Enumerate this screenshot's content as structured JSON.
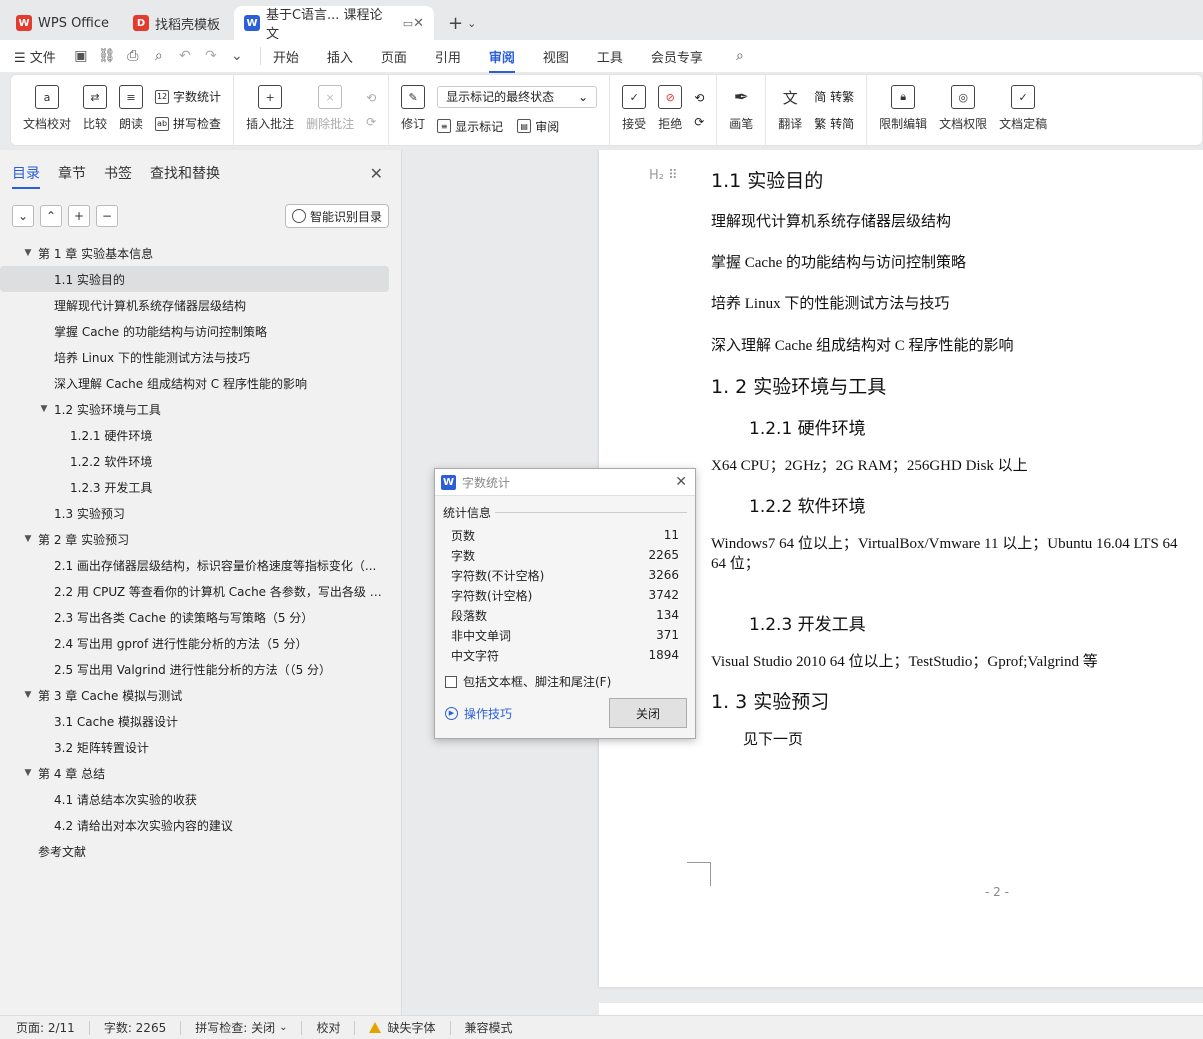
{
  "tabs": [
    {
      "label": "WPS Office",
      "logo": "W",
      "color": "#e33b2e"
    },
    {
      "label": "找稻壳模板",
      "logo": "D",
      "color": "#e33b2e"
    },
    {
      "label": "基于C语言... 课程论文",
      "logo": "W",
      "color": "#2b5fd9"
    }
  ],
  "menu": {
    "file": "文件",
    "nav": [
      "开始",
      "插入",
      "页面",
      "引用",
      "审阅",
      "视图",
      "工具",
      "会员专享"
    ],
    "active": "审阅"
  },
  "ribbon": {
    "doc_check": "文档校对",
    "compare": "比较",
    "read_aloud": "朗读",
    "word_count": "字数统计",
    "spell_check": "拼写检查",
    "insert_comment": "插入批注",
    "delete_comment": "删除批注",
    "revise": "修订",
    "display_state": "显示标记的最终状态",
    "show_markup": "显示标记",
    "review": "审阅",
    "accept": "接受",
    "reject": "拒绝",
    "pen": "画笔",
    "translate": "翻译",
    "to_trad": "简 转繁",
    "to_simp": "繁 转简",
    "restrict_edit": "限制编辑",
    "doc_permission": "文档权限",
    "doc_finalize": "文档定稿"
  },
  "leftpane": {
    "tabs": [
      "目录",
      "章节",
      "书签",
      "查找和替换"
    ],
    "smart_toc": "智能识别目录",
    "toc": [
      {
        "label": "第 1 章  实验基本信息",
        "level": 0,
        "expand": true
      },
      {
        "label": "1.1  实验目的",
        "level": 1,
        "selected": true
      },
      {
        "label": "理解现代计算机系统存储器层级结构",
        "level": 1
      },
      {
        "label": "掌握 Cache 的功能结构与访问控制策略",
        "level": 1
      },
      {
        "label": "培养 Linux 下的性能测试方法与技巧",
        "level": 1
      },
      {
        "label": "深入理解 Cache 组成结构对 C 程序性能的影响",
        "level": 1
      },
      {
        "label": "1.2  实验环境与工具",
        "level": 1,
        "expand": true
      },
      {
        "label": "1.2.1  硬件环境",
        "level": 2
      },
      {
        "label": "1.2.2  软件环境",
        "level": 2
      },
      {
        "label": "1.2.3  开发工具",
        "level": 2
      },
      {
        "label": "1.3  实验预习",
        "level": 1
      },
      {
        "label": "第 2 章  实验预习",
        "level": 0,
        "expand": true
      },
      {
        "label": "2.1  画出存储器层级结构，标识容量价格速度等指标变化（...",
        "level": 1
      },
      {
        "label": "2.2 用 CPUZ 等查看你的计算机 Cache 各参数，写出各级 C...",
        "level": 1
      },
      {
        "label": "2.3 写出各类 Cache 的读策略与写策略（5 分）",
        "level": 1
      },
      {
        "label": "2.4  写出用 gprof 进行性能分析的方法（5 分）",
        "level": 1
      },
      {
        "label": "2.5 写出用 Valgrind 进行性能分析的方法（（5 分）",
        "level": 1
      },
      {
        "label": "第 3 章  Cache 模拟与测试",
        "level": 0,
        "expand": true
      },
      {
        "label": "3.1 Cache 模拟器设计",
        "level": 1
      },
      {
        "label": "3.2  矩阵转置设计",
        "level": 1
      },
      {
        "label": "第 4 章  总结",
        "level": 0,
        "expand": true
      },
      {
        "label": "4.1  请总结本次实验的收获",
        "level": 1
      },
      {
        "label": "4.2  请给出对本次实验内容的建议",
        "level": 1
      },
      {
        "label": "参考文献",
        "level": 0
      }
    ]
  },
  "document": {
    "h11": "1.1  实验目的",
    "p1": "理解现代计算机系统存储器层级结构",
    "p2": "掌握 Cache 的功能结构与访问控制策略",
    "p3": "培养 Linux 下的性能测试方法与技巧",
    "p4": "深入理解 Cache 组成结构对 C 程序性能的影响",
    "h12": "1. 2  实验环境与工具",
    "h121": "1.2.1  硬件环境",
    "p5": "X64 CPU；2GHz；2G RAM；256GHD Disk  以上",
    "h122": "1.2.2  软件环境",
    "p6a": "Windows7 64 位以上；VirtualBox/Vmware 11 以上；Ubuntu 16.04 LTS 64",
    "p6b": "64 位；",
    "h123": "1.2.3  开发工具",
    "p7": "Visual Studio 2010 64 位以上；TestStudio；Gprof;Valgrind 等",
    "h13": "1. 3  实验预习",
    "p8": "见下一页",
    "page_number": "- 2 -"
  },
  "dialog": {
    "title": "字数统计",
    "group": "统计信息",
    "stats": [
      {
        "label": "页数",
        "value": "11"
      },
      {
        "label": "字数",
        "value": "2265"
      },
      {
        "label": "字符数(不计空格)",
        "value": "3266"
      },
      {
        "label": "字符数(计空格)",
        "value": "3742"
      },
      {
        "label": "段落数",
        "value": "134"
      },
      {
        "label": "非中文单词",
        "value": "371"
      },
      {
        "label": "中文字符",
        "value": "1894"
      }
    ],
    "checkbox": "包括文本框、脚注和尾注(F)",
    "tips": "操作技巧",
    "close": "关闭"
  },
  "status": {
    "page": "页面: 2/11",
    "words": "字数: 2265",
    "spell": "拼写检查: 关闭",
    "proof": "校对",
    "missing_font": "缺失字体",
    "compat": "兼容模式"
  }
}
